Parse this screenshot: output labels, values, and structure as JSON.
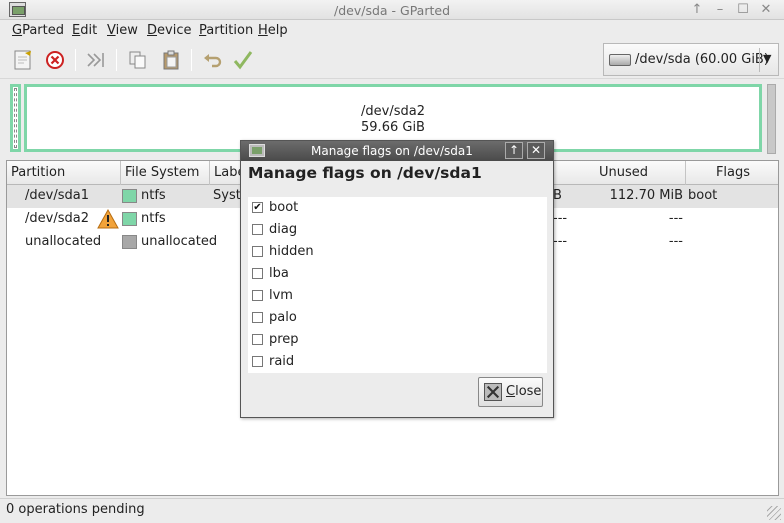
{
  "window": {
    "title": "/dev/sda - GParted",
    "controls": [
      "↑",
      "–",
      "☐",
      "✕"
    ]
  },
  "menu": [
    {
      "label": "GParted",
      "key": "G",
      "rest": "Parted"
    },
    {
      "label": "Edit",
      "key": "E",
      "rest": "dit"
    },
    {
      "label": "View",
      "key": "V",
      "rest": "iew"
    },
    {
      "label": "Device",
      "key": "D",
      "rest": "evice"
    },
    {
      "label": "Partition",
      "key": "P",
      "rest": "artition"
    },
    {
      "label": "Help",
      "key": "H",
      "rest": "elp"
    }
  ],
  "toolbar": {
    "icons": [
      "new-partition-icon",
      "delete-icon",
      "resize-move-icon",
      "copy-icon",
      "paste-icon",
      "undo-icon",
      "apply-icon"
    ]
  },
  "device_selector": {
    "label": "/dev/sda  (60.00 GiB)",
    "arrow": "▼"
  },
  "disk_graph": {
    "main_name": "/dev/sda2",
    "main_size": "59.66 GiB",
    "partition_color": "#7fd6a8"
  },
  "table": {
    "headers": [
      "Partition",
      "File System",
      "Label",
      "Unused",
      "Flags"
    ],
    "rows": [
      {
        "partition": "/dev/sda1",
        "fs": "ntfs",
        "fs_color": "#7fd6a8",
        "label": "Syst",
        "size_tail": "B",
        "unused": "112.70 MiB",
        "flags": "boot",
        "warning": false,
        "selected": true
      },
      {
        "partition": "/dev/sda2",
        "fs": "ntfs",
        "fs_color": "#7fd6a8",
        "label": "",
        "size_tail": "---",
        "unused": "---",
        "flags": "",
        "warning": true,
        "selected": false
      },
      {
        "partition": "unallocated",
        "fs": "unallocated",
        "fs_color": "#a8a8a8",
        "label": "",
        "size_tail": "---",
        "unused": "---",
        "flags": "",
        "warning": false,
        "selected": false
      }
    ]
  },
  "status": {
    "text": "0 operations pending"
  },
  "dialog": {
    "title": "Manage flags on /dev/sda1",
    "heading": "Manage flags on /dev/sda1",
    "title_buttons": [
      "↑",
      "✕"
    ],
    "flags": [
      {
        "name": "boot",
        "checked": true
      },
      {
        "name": "diag",
        "checked": false
      },
      {
        "name": "hidden",
        "checked": false
      },
      {
        "name": "lba",
        "checked": false
      },
      {
        "name": "lvm",
        "checked": false
      },
      {
        "name": "palo",
        "checked": false
      },
      {
        "name": "prep",
        "checked": false
      },
      {
        "name": "raid",
        "checked": false
      }
    ],
    "close_key": "C",
    "close_rest": "lose"
  }
}
